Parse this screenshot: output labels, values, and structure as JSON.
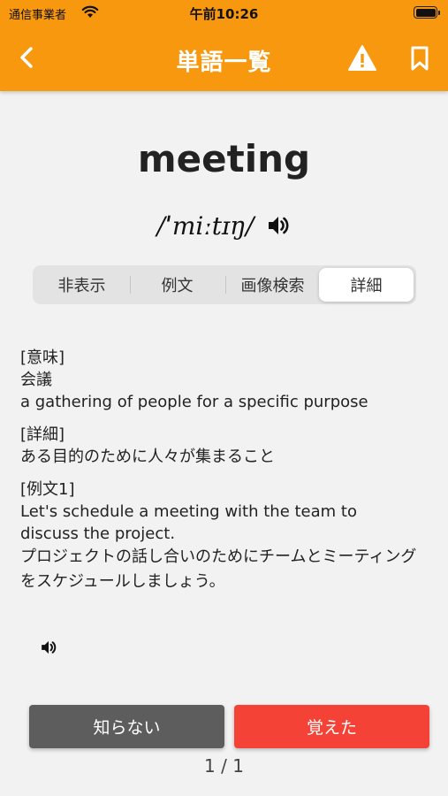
{
  "status_bar": {
    "carrier": "通信事業者",
    "time": "午前10:26"
  },
  "header": {
    "title": "単語一覧",
    "back_icon": "chevron-left-icon",
    "warning_icon": "warning-icon",
    "bookmark_icon": "bookmark-icon"
  },
  "colors": {
    "accent": "#f7980f",
    "unknown_button": "#5d5d5d",
    "known_button": "#f44336"
  },
  "word": {
    "text": "meeting",
    "pronunciation": "/ˈmiːtɪŋ/"
  },
  "tabs": [
    {
      "label": "非表示",
      "selected": false
    },
    {
      "label": "例文",
      "selected": false
    },
    {
      "label": "画像検索",
      "selected": false
    },
    {
      "label": "詳細",
      "selected": true
    }
  ],
  "detail": {
    "meaning_header": "[意味]",
    "meaning_ja": "会議",
    "meaning_en": "a gathering of people for a specific purpose",
    "detail_header": "[詳細]",
    "detail_text": "ある目的のために人々が集まること",
    "example_header": "[例文1]",
    "example_en": "Let's schedule a meeting with the team to discuss the project.",
    "example_ja": "プロジェクトの話し合いのためにチームとミーティングをスケジュールしましょう。"
  },
  "buttons": {
    "unknown": "知らない",
    "known": "覚えた"
  },
  "pager": "1 / 1"
}
